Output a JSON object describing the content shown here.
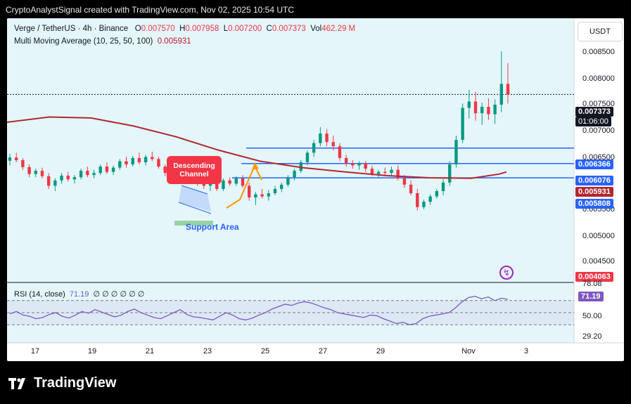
{
  "header": {
    "byline": "CryptoAnalystSignal created with TradingView.com, Nov 02, 2025 10:54 UTC"
  },
  "symbol": {
    "title": "Verge / TetherUS · 4h · Binance",
    "o_label": "O",
    "o": "0.007570",
    "h_label": "H",
    "h": "0.007958",
    "l_label": "L",
    "l": "0.007200",
    "c_label": "C",
    "c": "0.007373",
    "vol_label": "Vol",
    "vol": "462.29 M"
  },
  "indicator": {
    "label": "Multi Moving Average (10, 25, 50, 100)",
    "value": "0.005931"
  },
  "currency_button": "USDT",
  "rsi": {
    "label": "RSI (14, close)",
    "value": "71.19",
    "placeholders": "∅ ∅ ∅ ∅ ∅ ∅"
  },
  "price_axis": [
    "0.008500",
    "0.008000",
    "0.007500",
    "0.007000",
    "0.006500",
    "0.005500",
    "0.005000",
    "0.004500"
  ],
  "rsi_axis": [
    "78.08",
    "50.00",
    "29.20"
  ],
  "price_badges": {
    "last": "0.007373",
    "countdown": "01:06:00",
    "lvl1": "0.006366",
    "lvl2": "0.006076",
    "ma": "0.005931",
    "lvl3": "0.005808",
    "low": "0.004063",
    "rsi_value": "71.19"
  },
  "time_axis": [
    "17",
    "19",
    "21",
    "23",
    "25",
    "27",
    "29",
    "Nov",
    "3"
  ],
  "annotations": {
    "descending_channel": "Descending Channel",
    "support_area": "Support Area"
  },
  "branding": {
    "logo_text": "TradingView"
  },
  "colors": {
    "up": "#089981",
    "down": "#f23645",
    "ma": "#b2272f",
    "level": "#2962ff",
    "rsi": "#7e57c2",
    "arrow": "#ff9800"
  },
  "chart_data": {
    "type": "candlestick",
    "series_candles": [
      [
        0.00613,
        0.00626,
        0.00604,
        0.00619
      ],
      [
        0.00619,
        0.00628,
        0.0061,
        0.00614
      ],
      [
        0.00614,
        0.00618,
        0.00596,
        0.00601
      ],
      [
        0.00601,
        0.00606,
        0.00582,
        0.00588
      ],
      [
        0.00588,
        0.00598,
        0.00582,
        0.00594
      ],
      [
        0.00594,
        0.006,
        0.0058,
        0.00584
      ],
      [
        0.00584,
        0.0059,
        0.0056,
        0.00566
      ],
      [
        0.00566,
        0.0058,
        0.00556,
        0.00576
      ],
      [
        0.00576,
        0.0059,
        0.0057,
        0.00585
      ],
      [
        0.00585,
        0.00592,
        0.00574,
        0.00578
      ],
      [
        0.00578,
        0.00586,
        0.0057,
        0.00582
      ],
      [
        0.00582,
        0.00598,
        0.00578,
        0.00594
      ],
      [
        0.00594,
        0.00602,
        0.00582,
        0.00586
      ],
      [
        0.00586,
        0.00596,
        0.0058,
        0.0059
      ],
      [
        0.0059,
        0.00606,
        0.00586,
        0.00602
      ],
      [
        0.00602,
        0.0061,
        0.00588,
        0.00592
      ],
      [
        0.00592,
        0.00604,
        0.00586,
        0.006
      ],
      [
        0.006,
        0.00616,
        0.00596,
        0.00612
      ],
      [
        0.00612,
        0.0062,
        0.006,
        0.00606
      ],
      [
        0.00606,
        0.00622,
        0.00602,
        0.00618
      ],
      [
        0.00618,
        0.00628,
        0.00606,
        0.0061
      ],
      [
        0.0061,
        0.00624,
        0.00604,
        0.0062
      ],
      [
        0.0062,
        0.0063,
        0.00612,
        0.00616
      ],
      [
        0.00616,
        0.0062,
        0.00598,
        0.00602
      ],
      [
        0.00602,
        0.00606,
        0.00584,
        0.0059
      ],
      [
        0.0059,
        0.00604,
        0.00586,
        0.006
      ],
      [
        0.006,
        0.00618,
        0.00596,
        0.00612
      ],
      [
        0.00612,
        0.00618,
        0.0059,
        0.00594
      ],
      [
        0.00594,
        0.00598,
        0.00572,
        0.00578
      ],
      [
        0.00578,
        0.00586,
        0.00566,
        0.00582
      ],
      [
        0.00582,
        0.00588,
        0.0056,
        0.00566
      ],
      [
        0.00566,
        0.00574,
        0.00556,
        0.0057
      ],
      [
        0.0057,
        0.00576,
        0.00556,
        0.0056
      ],
      [
        0.0056,
        0.0058,
        0.00556,
        0.00576
      ],
      [
        0.00576,
        0.00582,
        0.00566,
        0.0057
      ],
      [
        0.0057,
        0.00584,
        0.00566,
        0.0058
      ],
      [
        0.0058,
        0.00586,
        0.00562,
        0.00566
      ],
      [
        0.00566,
        0.00572,
        0.00538,
        0.00544
      ],
      [
        0.00544,
        0.00554,
        0.0053,
        0.0055
      ],
      [
        0.0055,
        0.0056,
        0.00542,
        0.00546
      ],
      [
        0.00546,
        0.00558,
        0.00538,
        0.00552
      ],
      [
        0.00552,
        0.00566,
        0.00548,
        0.0056
      ],
      [
        0.0056,
        0.00572,
        0.00554,
        0.00568
      ],
      [
        0.00568,
        0.00586,
        0.00564,
        0.00582
      ],
      [
        0.00582,
        0.00598,
        0.00576,
        0.00594
      ],
      [
        0.00594,
        0.00614,
        0.0059,
        0.0061
      ],
      [
        0.0061,
        0.00632,
        0.00604,
        0.00628
      ],
      [
        0.00628,
        0.00652,
        0.0062,
        0.00646
      ],
      [
        0.00646,
        0.00676,
        0.0064,
        0.00664
      ],
      [
        0.00664,
        0.00672,
        0.0064,
        0.00648
      ],
      [
        0.00648,
        0.0066,
        0.00632,
        0.0064
      ],
      [
        0.0064,
        0.00646,
        0.00612,
        0.00618
      ],
      [
        0.00618,
        0.00624,
        0.00602,
        0.00608
      ],
      [
        0.00608,
        0.00614,
        0.00598,
        0.00604
      ],
      [
        0.00604,
        0.00612,
        0.00596,
        0.00608
      ],
      [
        0.00608,
        0.00612,
        0.00592,
        0.00598
      ],
      [
        0.00598,
        0.00604,
        0.00584,
        0.00588
      ],
      [
        0.00588,
        0.00596,
        0.0058,
        0.00592
      ],
      [
        0.00592,
        0.006,
        0.00584,
        0.0059
      ],
      [
        0.0059,
        0.00602,
        0.00584,
        0.00596
      ],
      [
        0.00596,
        0.00604,
        0.00576,
        0.0058
      ],
      [
        0.0058,
        0.00586,
        0.00562,
        0.00568
      ],
      [
        0.00568,
        0.00576,
        0.00548,
        0.00552
      ],
      [
        0.00552,
        0.0056,
        0.0052,
        0.00526
      ],
      [
        0.00526,
        0.0054,
        0.00522,
        0.00536
      ],
      [
        0.00536,
        0.0055,
        0.0053,
        0.00546
      ],
      [
        0.00546,
        0.0056,
        0.00542,
        0.00556
      ],
      [
        0.00556,
        0.00578,
        0.00548,
        0.00572
      ],
      [
        0.00572,
        0.00612,
        0.00566,
        0.00606
      ],
      [
        0.00606,
        0.0066,
        0.006,
        0.00652
      ],
      [
        0.00652,
        0.0072,
        0.00646,
        0.00712
      ],
      [
        0.00712,
        0.00746,
        0.00692,
        0.00724
      ],
      [
        0.00724,
        0.00742,
        0.00688,
        0.00702
      ],
      [
        0.00702,
        0.00722,
        0.0068,
        0.00714
      ],
      [
        0.00714,
        0.0073,
        0.0069,
        0.007
      ],
      [
        0.007,
        0.00728,
        0.00682,
        0.00718
      ],
      [
        0.00718,
        0.00818,
        0.00704,
        0.00757
      ],
      [
        0.00757,
        0.00796,
        0.0072,
        0.00737
      ]
    ],
    "moving_average": [
      [
        0,
        0.00685
      ],
      [
        60,
        0.00695
      ],
      [
        120,
        0.00693
      ],
      [
        180,
        0.00678
      ],
      [
        240,
        0.00658
      ],
      [
        300,
        0.00633
      ],
      [
        360,
        0.00612
      ],
      [
        420,
        0.006
      ],
      [
        480,
        0.00592
      ],
      [
        540,
        0.00585
      ],
      [
        600,
        0.00581
      ],
      [
        660,
        0.0058
      ],
      [
        700,
        0.00588
      ],
      [
        710,
        0.00592
      ]
    ],
    "levels": [
      0.006366,
      0.006076,
      0.005808
    ],
    "rsi_values": [
      48,
      52,
      46,
      44,
      40,
      42,
      47,
      50,
      44,
      41,
      46,
      52,
      49,
      55,
      51,
      47,
      43,
      46,
      52,
      56,
      50,
      46,
      42,
      40,
      45,
      50,
      55,
      47,
      43,
      42,
      40,
      38,
      44,
      50,
      46,
      40,
      38,
      41,
      46,
      50,
      56,
      60,
      64,
      62,
      66,
      68,
      66,
      62,
      58,
      55,
      50,
      48,
      46,
      44,
      42,
      46,
      45,
      40,
      36,
      32,
      34,
      30,
      32,
      40,
      44,
      46,
      48,
      50,
      58,
      68,
      75,
      77,
      73,
      76,
      70,
      74,
      72
    ],
    "x_ticks": [
      "17",
      "19",
      "21",
      "23",
      "25",
      "27",
      "29",
      "Nov",
      "3"
    ],
    "y_range": [
      0.0039,
      0.0088
    ],
    "rsi_range": [
      0,
      100
    ]
  }
}
